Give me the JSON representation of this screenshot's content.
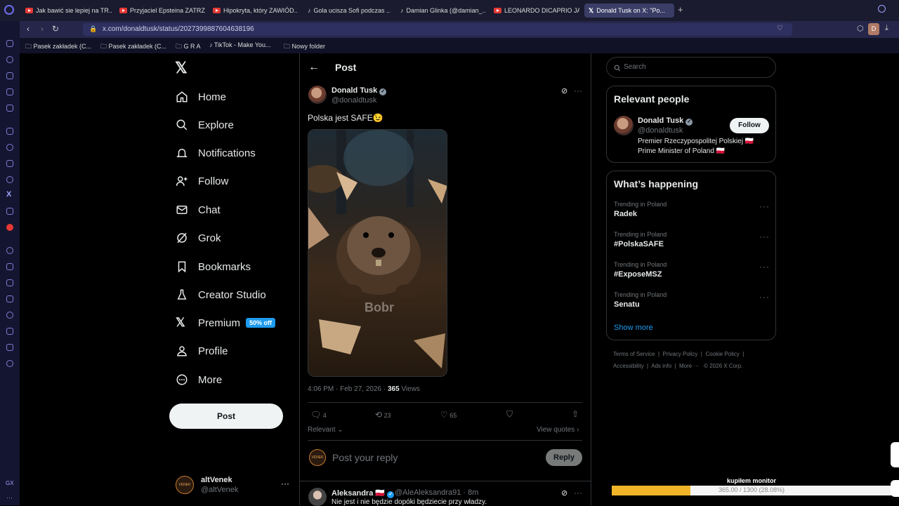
{
  "browser": {
    "tabs": [
      {
        "label": "Jak bawić sie lepiej na TR...",
        "icon": "youtube-icon"
      },
      {
        "label": "Przyjaciel Epsteina ZATRZ...",
        "icon": "youtube-icon"
      },
      {
        "label": "Hipokryta, który ZAWIÓD...",
        "icon": "youtube-icon"
      },
      {
        "label": "Gola ucisza Sofi podczas ...",
        "icon": "tiktok-icon"
      },
      {
        "label": "Damian Glinka (@damian_...",
        "icon": "tiktok-icon"
      },
      {
        "label": "LEONARDO DICAPRIO JA...",
        "icon": "youtube-icon"
      },
      {
        "label": "Donald Tusk on X: \"Po...",
        "icon": "x-icon"
      }
    ],
    "url": "x.com/donaldtusk/status/2027399887604638196",
    "bookmarks": [
      "Pasek zakładek (C...",
      "Pasek zakładek (C...",
      "G R A",
      "TikTok - Make You...",
      "Nowy folder"
    ],
    "profile_initial": "D"
  },
  "nav": {
    "items": [
      "Home",
      "Explore",
      "Notifications",
      "Follow",
      "Chat",
      "Grok",
      "Bookmarks",
      "Creator Studio",
      "Premium",
      "Profile",
      "More"
    ],
    "premium_badge": "50% off",
    "post_label": "Post",
    "account_name": "altVenek",
    "account_handle": "@altVenek"
  },
  "post": {
    "header": "Post",
    "author_name": "Donald Tusk",
    "author_handle": "@donaldtusk",
    "text": "Polska jest SAFE😉",
    "image_caption": "Bobr",
    "time": "4:06 PM · Feb 27, 2026 · ",
    "views_count": "365",
    "views_label": " Views",
    "replies": "4",
    "reposts": "23",
    "likes": "65",
    "sort_label": "Relevant",
    "view_quotes": "View quotes",
    "reply_placeholder": "Post your reply",
    "reply_button": "Reply"
  },
  "comment": {
    "author_name": "Aleksandra 🇵🇱",
    "author_meta": "@AleAleksandra91 · 8m",
    "text": "Nie jest i nie będzie dopóki będziecie przy władzy."
  },
  "right": {
    "search_placeholder": "Search",
    "relevant_title": "Relevant people",
    "person_name": "Donald Tusk",
    "person_handle": "@donaldtusk",
    "follow_label": "Follow",
    "bio_line1": "Premier Rzeczypospolitej Polskiej 🇵🇱",
    "bio_line2": "Prime Minister of Poland 🇵🇱",
    "happening_title": "What’s happening",
    "trends": [
      {
        "context": "Trending in Poland",
        "name": "Radek"
      },
      {
        "context": "Trending in Poland",
        "name": "#PolskaSAFE"
      },
      {
        "context": "Trending in Poland",
        "name": "#ExposeMSZ"
      },
      {
        "context": "Trending in Poland",
        "name": "Senatu"
      }
    ],
    "show_more": "Show more",
    "footer_line1": [
      "Terms of Service",
      "Privacy Policy",
      "Cookie Policy"
    ],
    "footer_line2": [
      "Accessibility",
      "Ads info",
      "More ···",
      "© 2026 X Corp."
    ]
  },
  "overlay": {
    "title": "kupiłem monitor",
    "progress_text": "365.00 / 1300 (28.08%)",
    "progress_fraction": 0.2808,
    "bar_color": "#f0b429"
  }
}
